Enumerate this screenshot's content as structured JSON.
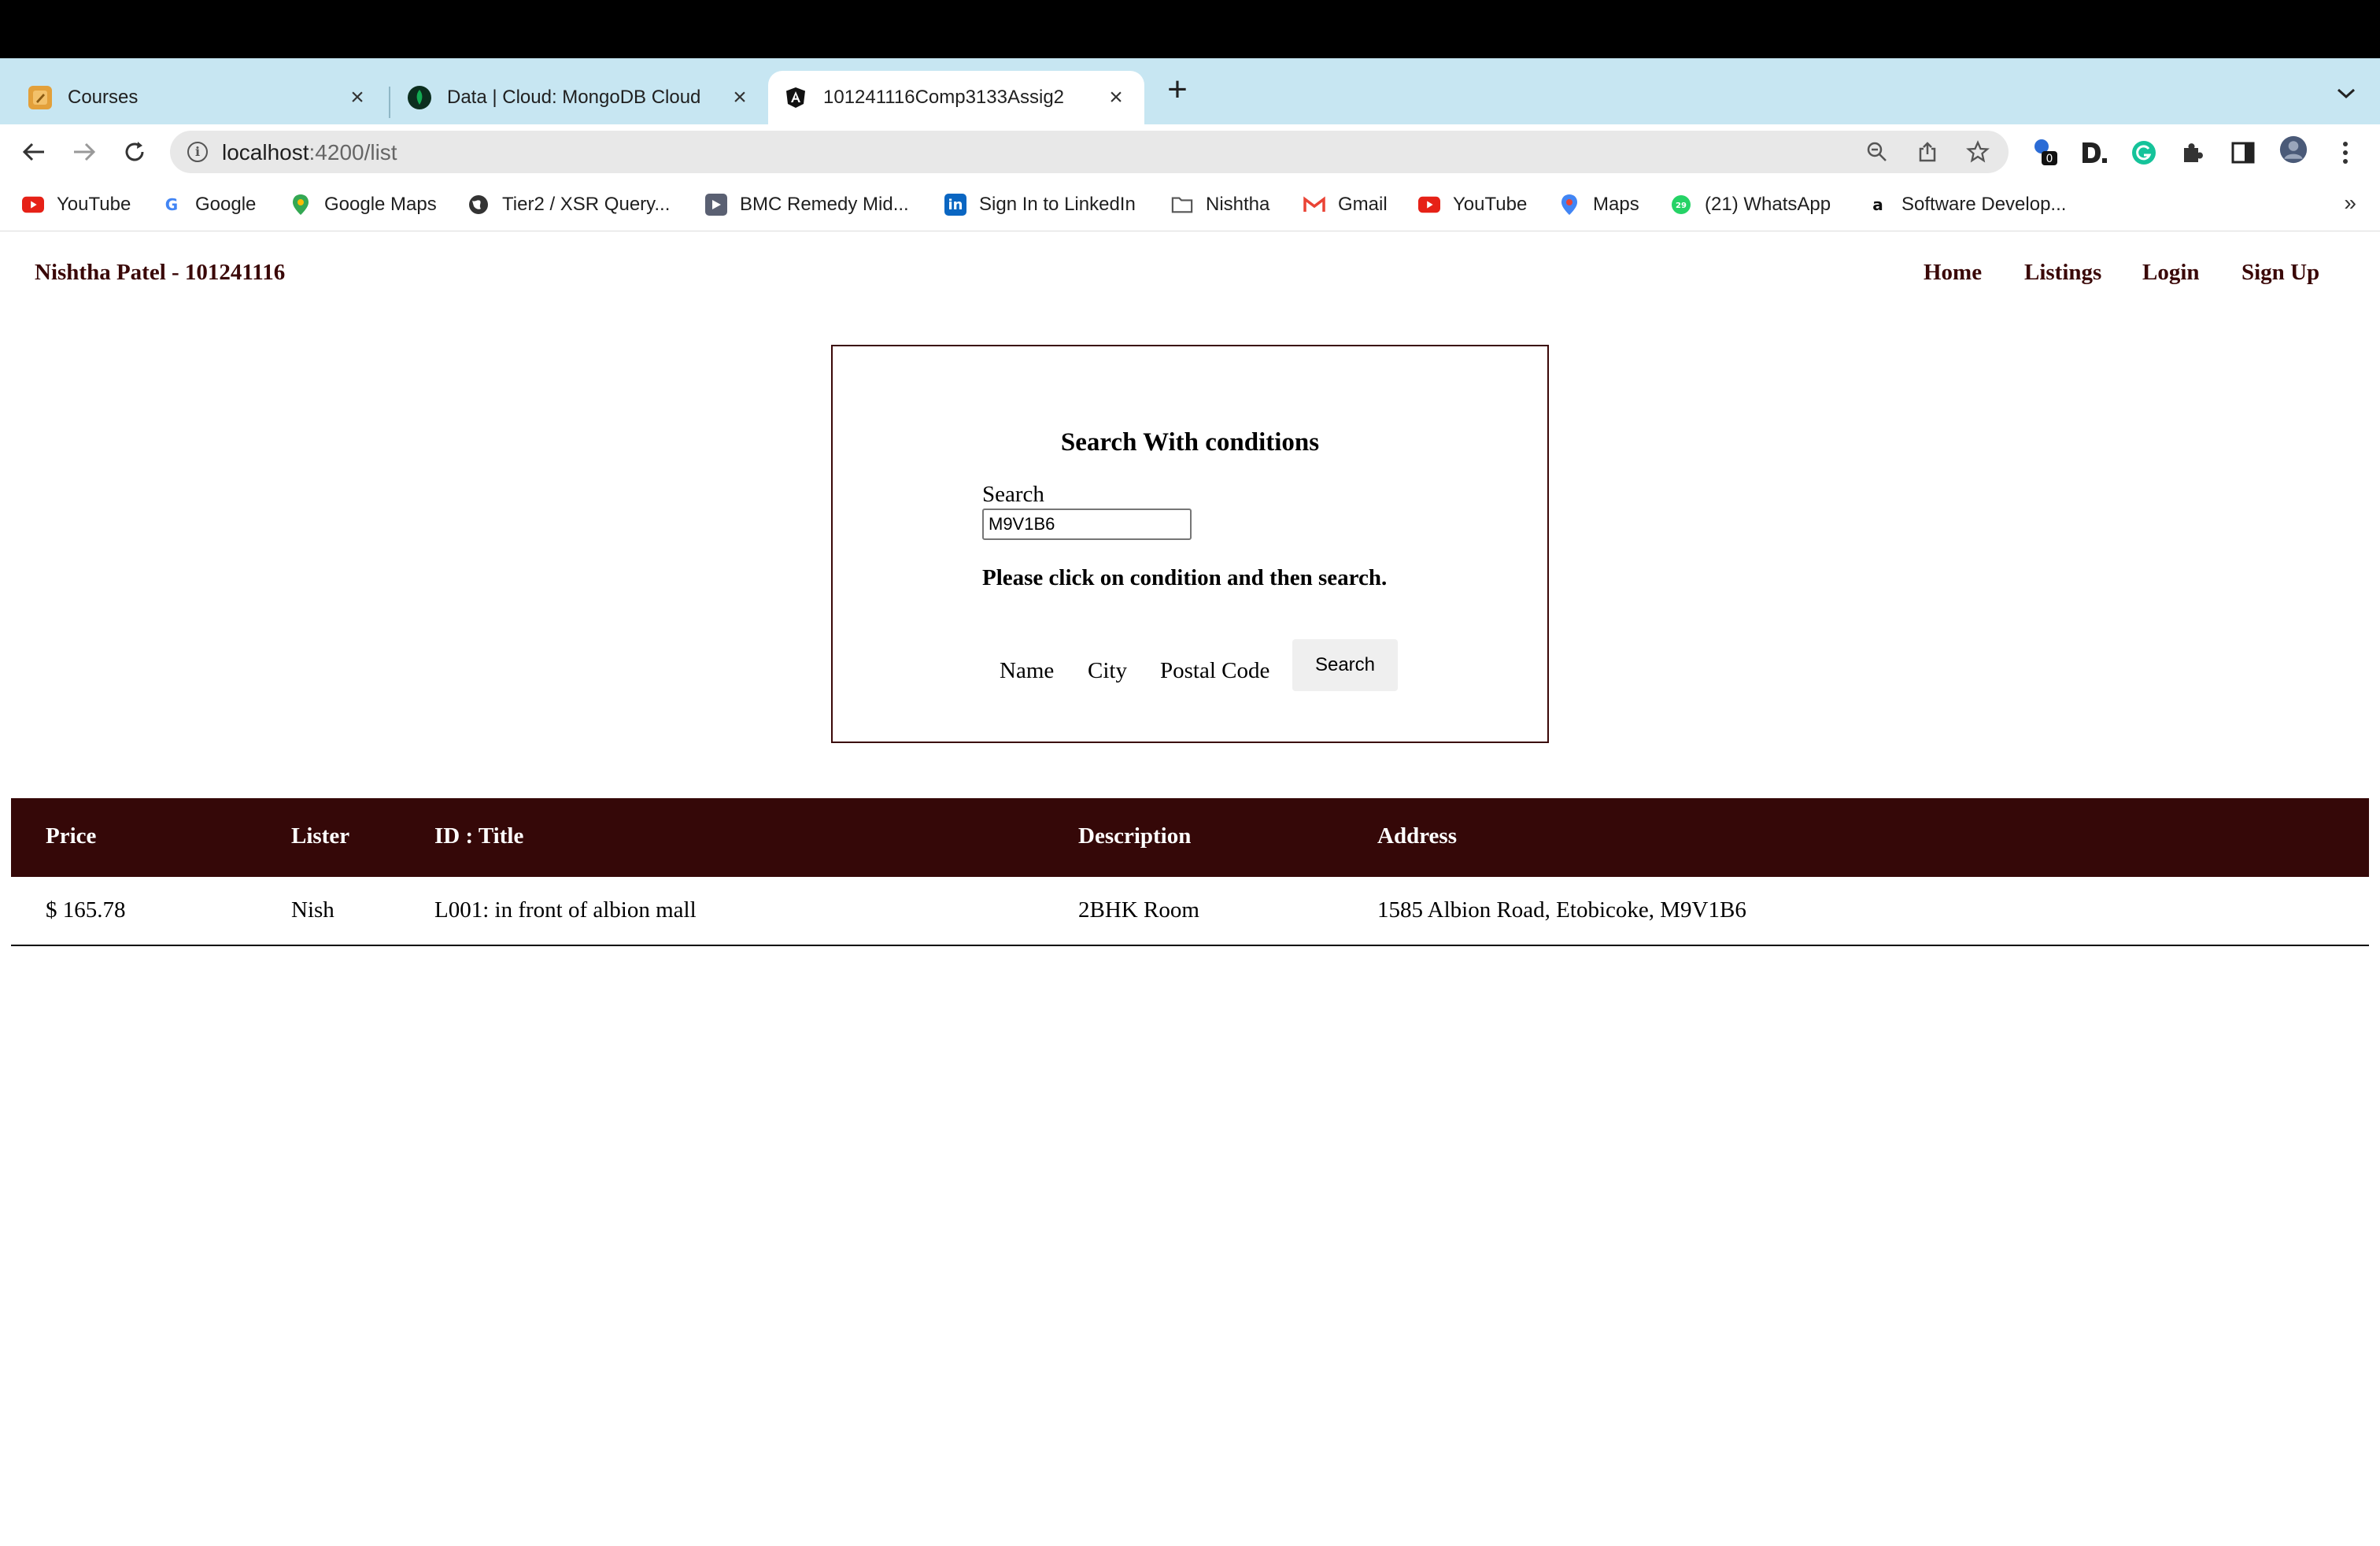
{
  "browser": {
    "tabs": [
      {
        "label": "Courses",
        "icon": "pencil-note-icon",
        "close": "×"
      },
      {
        "label": "Data | Cloud: MongoDB Cloud",
        "icon": "mongodb-leaf-icon",
        "close": "×"
      },
      {
        "label": "101241116Comp3133Assig2",
        "icon": "angular-icon",
        "close": "×"
      }
    ],
    "new_tab": "+",
    "tab_menu": "⌄",
    "url_host": "localhost",
    "url_path": ":4200/list",
    "extension_badge": "0",
    "bookmarks": [
      {
        "label": "YouTube",
        "icon": "youtube-icon"
      },
      {
        "label": "Google",
        "icon": "google-icon"
      },
      {
        "label": "Google Maps",
        "icon": "maps-pin-icon"
      },
      {
        "label": "Tier2 / XSR Query...",
        "icon": "globe-icon"
      },
      {
        "label": "BMC Remedy Mid...",
        "icon": "bmc-icon"
      },
      {
        "label": "Sign In to LinkedIn",
        "icon": "linkedin-icon"
      },
      {
        "label": "Nishtha",
        "icon": "folder-icon"
      },
      {
        "label": "Gmail",
        "icon": "gmail-icon"
      },
      {
        "label": "YouTube",
        "icon": "youtube-icon"
      },
      {
        "label": "Maps",
        "icon": "maps-pin-icon"
      },
      {
        "label": "(21) WhatsApp",
        "icon": "whatsapp-icon"
      },
      {
        "label": "Software Develop...",
        "icon": "amazon-icon"
      }
    ],
    "bookmarks_more": "»"
  },
  "header": {
    "brand": "Nishtha Patel - 101241116",
    "nav": [
      "Home",
      "Listings",
      "Login",
      "Sign Up"
    ]
  },
  "search": {
    "title": "Search With conditions",
    "label": "Search",
    "value": "M9V1B6",
    "hint": "Please click on condition and then search.",
    "conditions": [
      "Name",
      "City",
      "Postal Code"
    ],
    "button": "Search"
  },
  "table": {
    "columns": [
      "Price",
      "Lister",
      "ID : Title",
      "Description",
      "Address"
    ],
    "rows": [
      [
        "$ 165.78",
        "Nish",
        "L001: in front of albion mall",
        "2BHK Room",
        "1585 Albion Road, Etobicoke, M9V1B6"
      ]
    ]
  },
  "colors": {
    "accent": "#350808",
    "tabstrip": "#c7e6f2"
  }
}
